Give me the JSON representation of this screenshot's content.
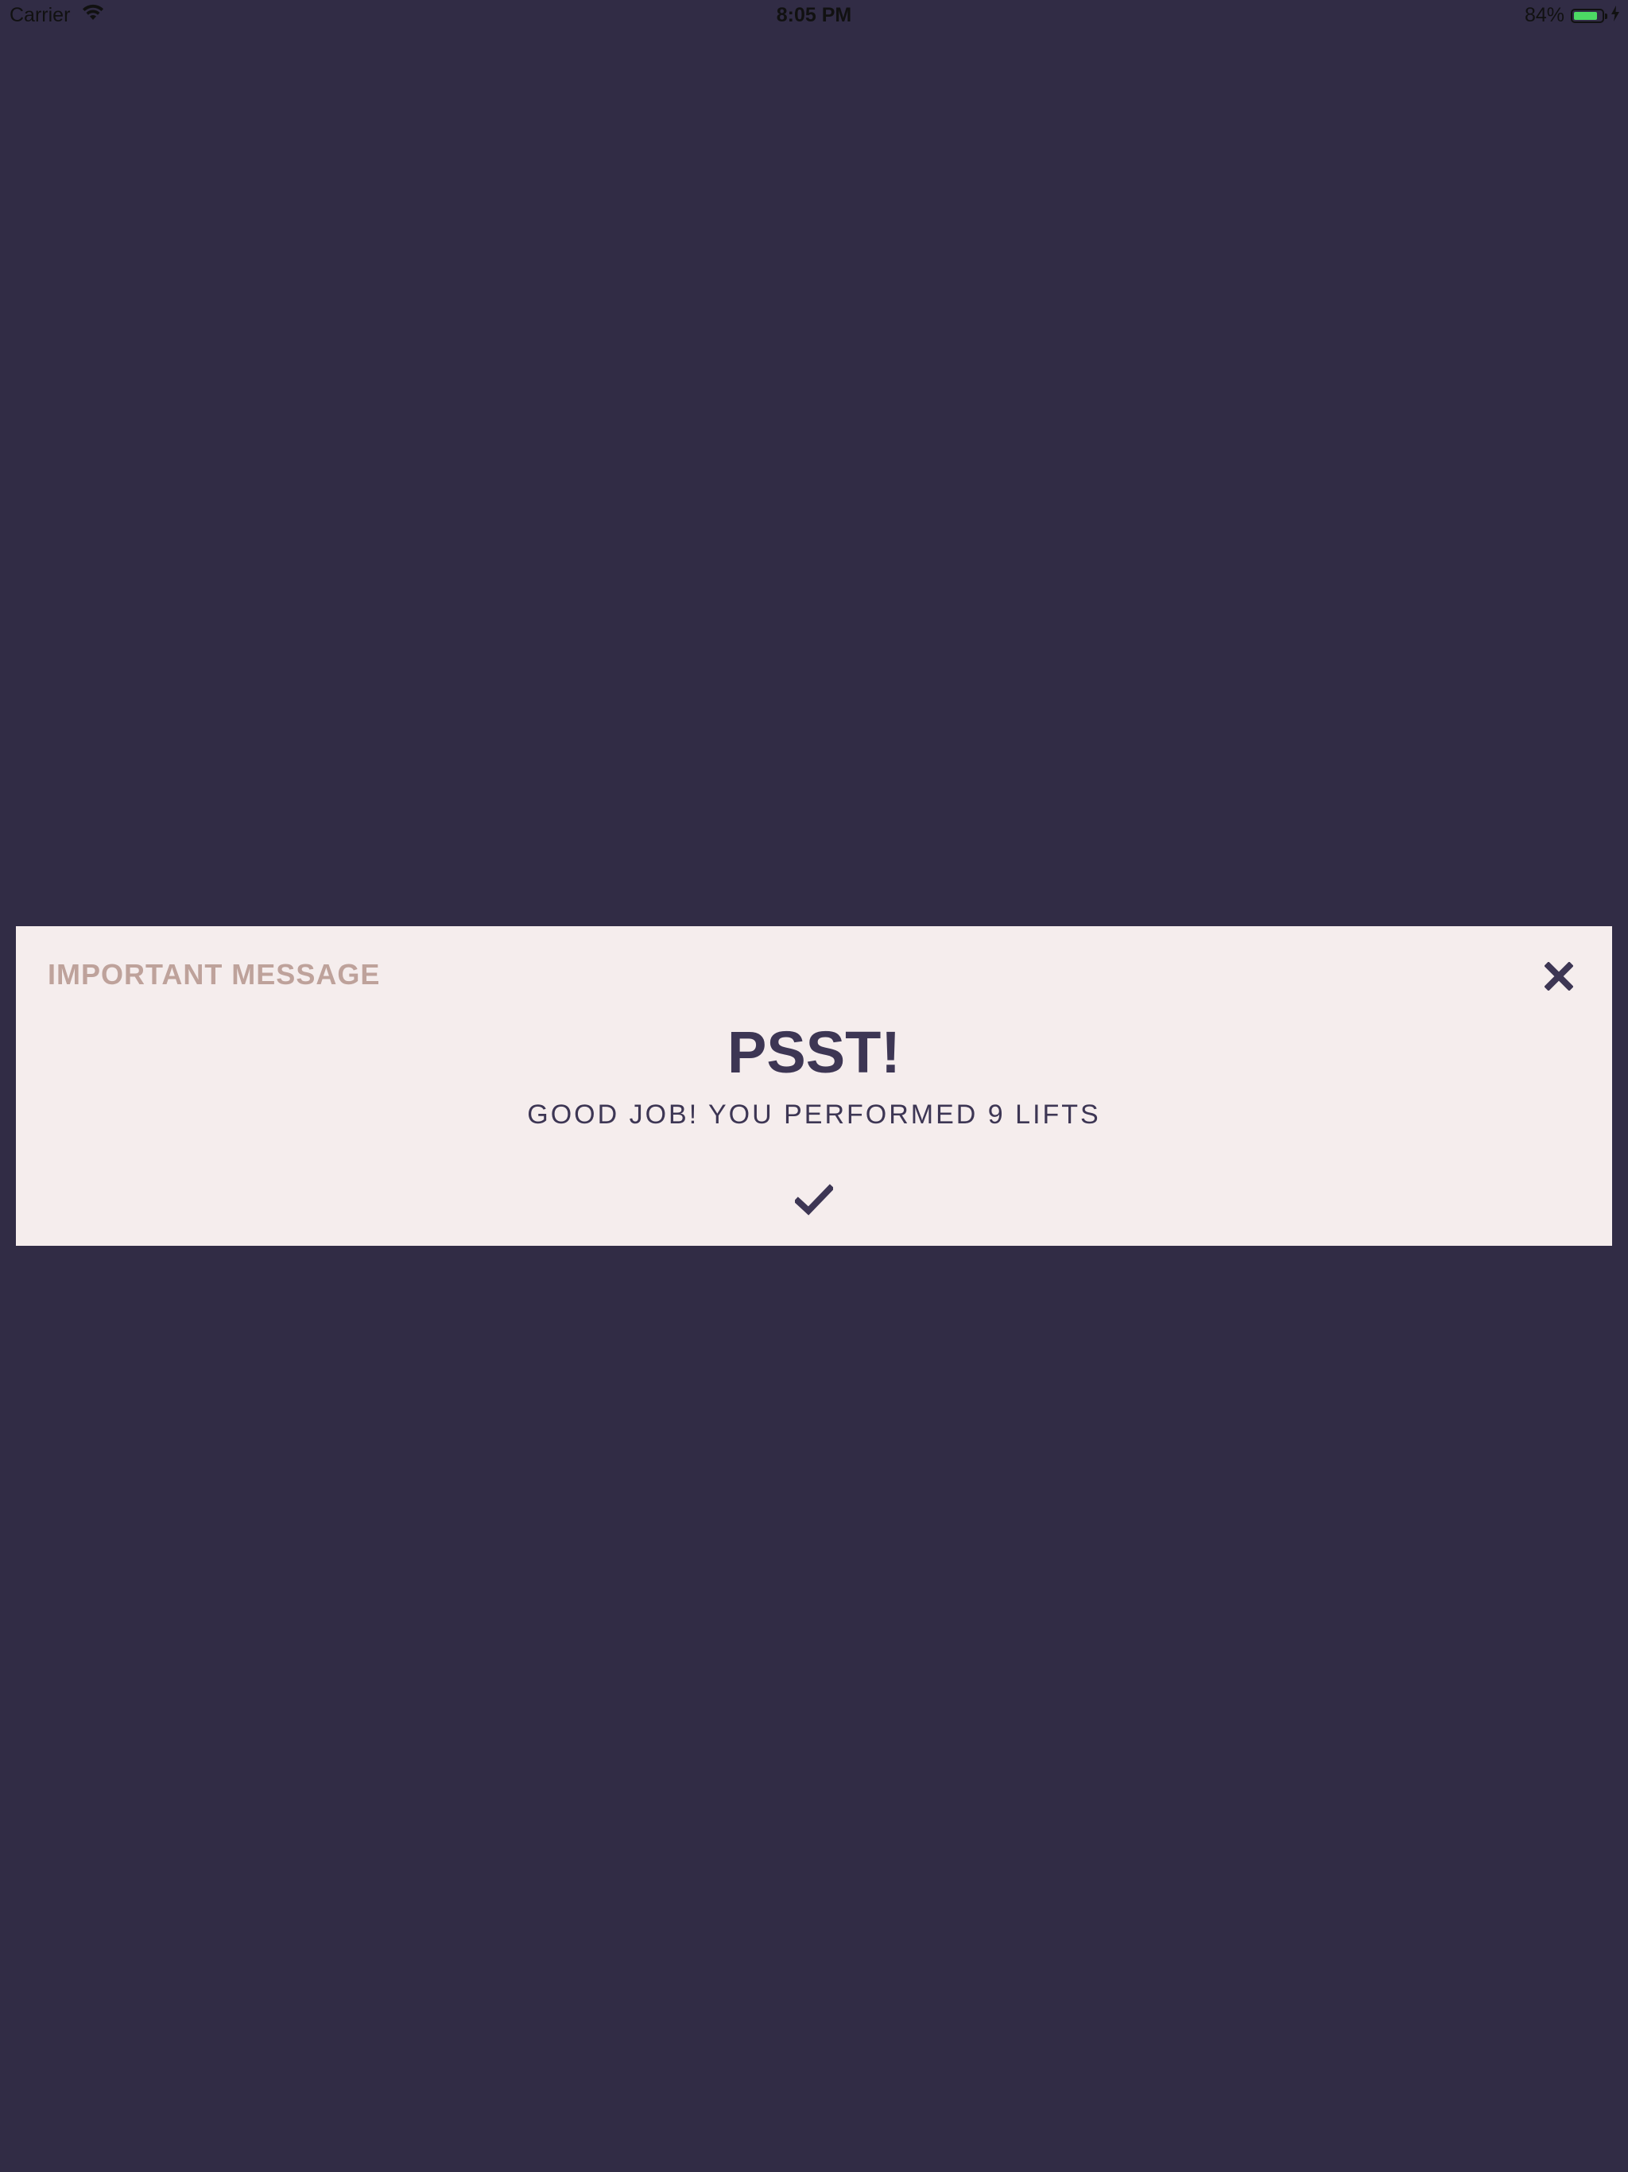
{
  "status_bar": {
    "carrier": "Carrier",
    "time": "8:05 PM",
    "battery_percent": "84%",
    "battery_level": 0.84,
    "wifi_icon": "wifi-icon",
    "charging_icon": "bolt-icon"
  },
  "modal": {
    "header_label": "IMPORTANT MESSAGE",
    "title": "PSST!",
    "message": "GOOD JOB! YOU PERFORMED 9 LIFTS",
    "close_icon": "close-icon",
    "confirm_icon": "checkmark-icon"
  },
  "colors": {
    "background": "#312c45",
    "modal_background": "#f5eded",
    "header_label": "#bea29b",
    "text_primary": "#3d3654",
    "battery_fill": "#4cd964"
  }
}
